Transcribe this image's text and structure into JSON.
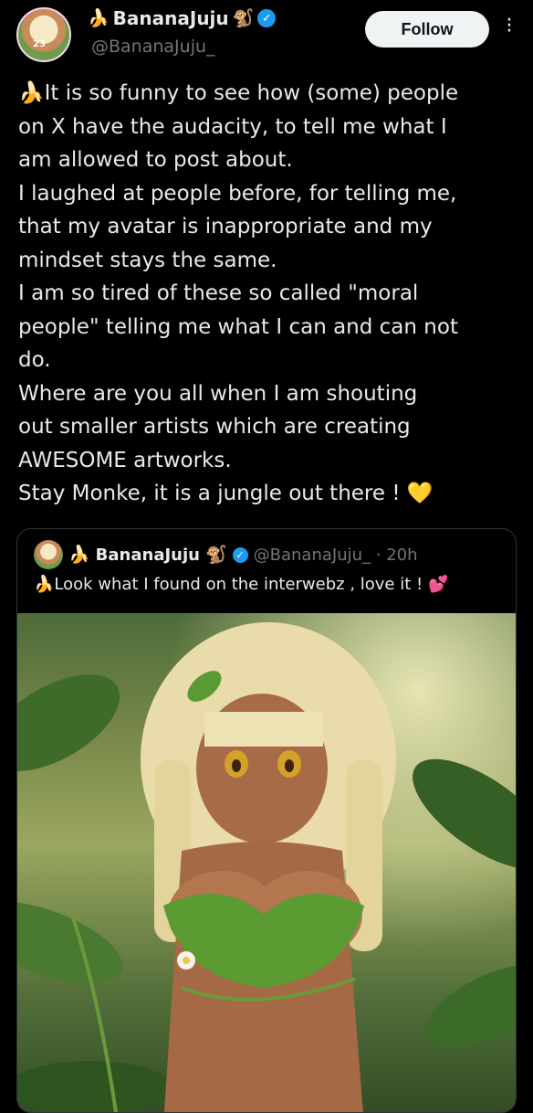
{
  "author": {
    "name": "BananaJuju",
    "name_prefix_emoji": "🍌",
    "name_suffix_emoji": "🐒",
    "handle": "@BananaJuju_",
    "avatar_badge": "23"
  },
  "follow_label": "Follow",
  "tweet_text": "🍌It is so funny to see how (some) people\non X have the audacity, to tell me what I\nam allowed to post about.\nI laughed at people before, for telling me,\nthat my avatar is inappropriate and my\nmindset stays the same.\nI am so tired of these so called \"moral\npeople\" telling me what I can and can not\ndo.\nWhere are you all when I am shouting\nout smaller artists which are creating\nAWESOME artworks.\nStay Monke, it is a jungle out there ! 💛",
  "quote": {
    "name": "BananaJuju",
    "name_prefix_emoji": "🍌",
    "name_suffix_emoji": "🐒",
    "handle_time": "@BananaJuju_ · 20h",
    "text": "🍌Look what I found on the interwebz , love it ! 💕"
  },
  "colors": {
    "background": "#000000",
    "text": "#e7e9ea",
    "muted": "#71767b",
    "verified": "#1d9bf0",
    "follow_bg": "#eff3f4"
  }
}
